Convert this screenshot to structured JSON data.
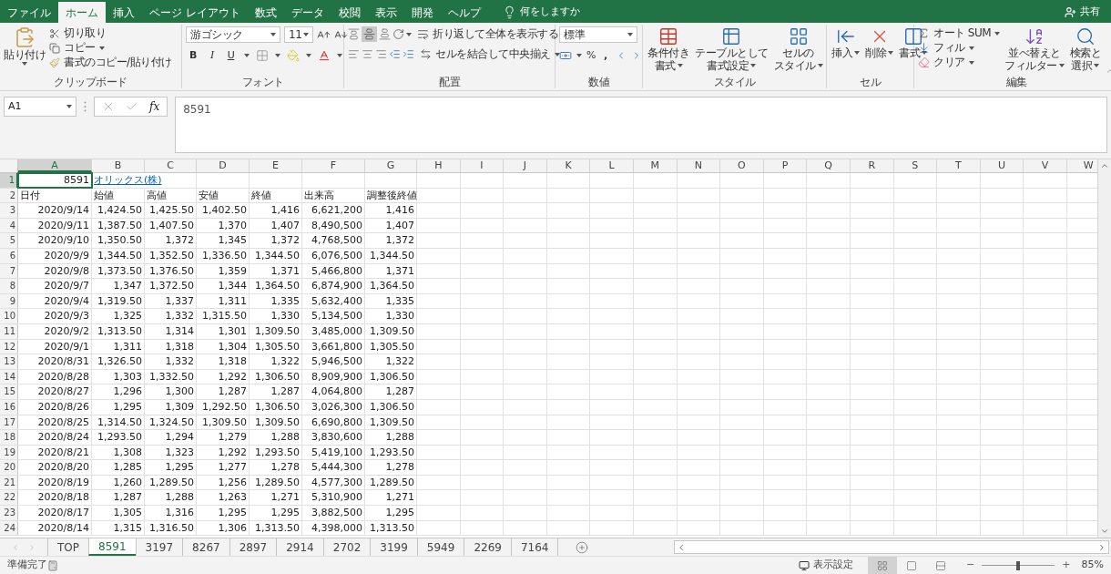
{
  "menu_tabs": [
    {
      "label": "ファイル",
      "selected": false
    },
    {
      "label": "ホーム",
      "selected": true
    },
    {
      "label": "挿入",
      "selected": false
    },
    {
      "label": "ページ レイアウト",
      "selected": false
    },
    {
      "label": "数式",
      "selected": false
    },
    {
      "label": "データ",
      "selected": false
    },
    {
      "label": "校閲",
      "selected": false
    },
    {
      "label": "表示",
      "selected": false
    },
    {
      "label": "開発",
      "selected": false
    },
    {
      "label": "ヘルプ",
      "selected": false
    }
  ],
  "tell_me": "何をしますか",
  "share": "共有",
  "ribbon": {
    "clipboard": {
      "paste": "貼り付け",
      "cut": "切り取り",
      "copy": "コピー",
      "format_painter": "書式のコピー/貼り付け",
      "label": "クリップボード"
    },
    "font": {
      "name": "游ゴシック",
      "size": "11",
      "bold": "B",
      "italic": "I",
      "underline": "U",
      "label": "フォント"
    },
    "alignment": {
      "wrap": "折り返して全体を表示する",
      "merge": "セルを結合して中央揃え",
      "label": "配置"
    },
    "number": {
      "format": "標準",
      "percent": "%",
      "comma": ",",
      "label": "数値"
    },
    "styles": {
      "conditional": [
        "条件付き",
        "書式"
      ],
      "table": [
        "テーブルとして",
        "書式設定"
      ],
      "cell_styles": [
        "セルの",
        "スタイル"
      ],
      "label": "スタイル"
    },
    "cells": {
      "insert": "挿入",
      "delete": "削除",
      "format": "書式",
      "label": "セル"
    },
    "editing": {
      "autosum": "オート SUM",
      "fill": "フィル",
      "clear": "クリア",
      "sort": [
        "並べ替えと",
        "フィルター"
      ],
      "find": [
        "検索と",
        "選択"
      ],
      "label": "編集"
    }
  },
  "name_box": "A1",
  "function_button": "fx",
  "formula": "8591",
  "columns": [
    {
      "label": "A",
      "selected": true
    },
    {
      "label": "B",
      "selected": false
    },
    {
      "label": "C",
      "selected": false
    },
    {
      "label": "D",
      "selected": false
    },
    {
      "label": "E",
      "selected": false
    },
    {
      "label": "F",
      "selected": false
    },
    {
      "label": "G",
      "selected": false
    },
    {
      "label": "H",
      "selected": false
    },
    {
      "label": "I",
      "selected": false
    },
    {
      "label": "J",
      "selected": false
    },
    {
      "label": "K",
      "selected": false
    },
    {
      "label": "L",
      "selected": false
    },
    {
      "label": "M",
      "selected": false
    },
    {
      "label": "N",
      "selected": false
    },
    {
      "label": "O",
      "selected": false
    },
    {
      "label": "P",
      "selected": false
    },
    {
      "label": "Q",
      "selected": false
    },
    {
      "label": "R",
      "selected": false
    },
    {
      "label": "S",
      "selected": false
    },
    {
      "label": "T",
      "selected": false
    },
    {
      "label": "U",
      "selected": false
    },
    {
      "label": "V",
      "selected": false
    },
    {
      "label": "W",
      "selected": false
    }
  ],
  "rows": [
    {
      "number": "1",
      "selected": true,
      "kind": "title",
      "cells": [
        "8591",
        "オリックス(株)"
      ]
    },
    {
      "number": "2",
      "selected": false,
      "kind": "header",
      "cells": [
        "日付",
        "始値",
        "高値",
        "安値",
        "終値",
        "出来高",
        "調整後終値"
      ]
    },
    {
      "number": "3",
      "selected": false,
      "kind": "data",
      "cells": [
        "2020/9/14",
        "1,424.50",
        "1,425.50",
        "1,402.50",
        "1,416",
        "6,621,200",
        "1,416"
      ]
    },
    {
      "number": "4",
      "selected": false,
      "kind": "data",
      "cells": [
        "2020/9/11",
        "1,387.50",
        "1,407.50",
        "1,370",
        "1,407",
        "8,490,500",
        "1,407"
      ]
    },
    {
      "number": "5",
      "selected": false,
      "kind": "data",
      "cells": [
        "2020/9/10",
        "1,350.50",
        "1,372",
        "1,345",
        "1,372",
        "4,768,500",
        "1,372"
      ]
    },
    {
      "number": "6",
      "selected": false,
      "kind": "data",
      "cells": [
        "2020/9/9",
        "1,344.50",
        "1,352.50",
        "1,336.50",
        "1,344.50",
        "6,076,500",
        "1,344.50"
      ]
    },
    {
      "number": "7",
      "selected": false,
      "kind": "data",
      "cells": [
        "2020/9/8",
        "1,373.50",
        "1,376.50",
        "1,359",
        "1,371",
        "5,466,800",
        "1,371"
      ]
    },
    {
      "number": "8",
      "selected": false,
      "kind": "data",
      "cells": [
        "2020/9/7",
        "1,347",
        "1,372.50",
        "1,344",
        "1,364.50",
        "6,874,900",
        "1,364.50"
      ]
    },
    {
      "number": "9",
      "selected": false,
      "kind": "data",
      "cells": [
        "2020/9/4",
        "1,319.50",
        "1,337",
        "1,311",
        "1,335",
        "5,632,400",
        "1,335"
      ]
    },
    {
      "number": "10",
      "selected": false,
      "kind": "data",
      "cells": [
        "2020/9/3",
        "1,325",
        "1,332",
        "1,315.50",
        "1,330",
        "5,134,500",
        "1,330"
      ]
    },
    {
      "number": "11",
      "selected": false,
      "kind": "data",
      "cells": [
        "2020/9/2",
        "1,313.50",
        "1,314",
        "1,301",
        "1,309.50",
        "3,485,000",
        "1,309.50"
      ]
    },
    {
      "number": "12",
      "selected": false,
      "kind": "data",
      "cells": [
        "2020/9/1",
        "1,311",
        "1,318",
        "1,304",
        "1,305.50",
        "3,661,800",
        "1,305.50"
      ]
    },
    {
      "number": "13",
      "selected": false,
      "kind": "data",
      "cells": [
        "2020/8/31",
        "1,326.50",
        "1,332",
        "1,318",
        "1,322",
        "5,946,500",
        "1,322"
      ]
    },
    {
      "number": "14",
      "selected": false,
      "kind": "data",
      "cells": [
        "2020/8/28",
        "1,303",
        "1,332.50",
        "1,292",
        "1,306.50",
        "8,909,900",
        "1,306.50"
      ]
    },
    {
      "number": "15",
      "selected": false,
      "kind": "data",
      "cells": [
        "2020/8/27",
        "1,296",
        "1,300",
        "1,287",
        "1,287",
        "4,064,800",
        "1,287"
      ]
    },
    {
      "number": "16",
      "selected": false,
      "kind": "data",
      "cells": [
        "2020/8/26",
        "1,295",
        "1,309",
        "1,292.50",
        "1,306.50",
        "3,026,300",
        "1,306.50"
      ]
    },
    {
      "number": "17",
      "selected": false,
      "kind": "data",
      "cells": [
        "2020/8/25",
        "1,314.50",
        "1,324.50",
        "1,309.50",
        "1,309.50",
        "6,690,800",
        "1,309.50"
      ]
    },
    {
      "number": "18",
      "selected": false,
      "kind": "data",
      "cells": [
        "2020/8/24",
        "1,293.50",
        "1,294",
        "1,279",
        "1,288",
        "3,830,600",
        "1,288"
      ]
    },
    {
      "number": "19",
      "selected": false,
      "kind": "data",
      "cells": [
        "2020/8/21",
        "1,308",
        "1,323",
        "1,292",
        "1,293.50",
        "5,419,100",
        "1,293.50"
      ]
    },
    {
      "number": "20",
      "selected": false,
      "kind": "data",
      "cells": [
        "2020/8/20",
        "1,285",
        "1,295",
        "1,277",
        "1,278",
        "5,444,300",
        "1,278"
      ]
    },
    {
      "number": "21",
      "selected": false,
      "kind": "data",
      "cells": [
        "2020/8/19",
        "1,260",
        "1,289.50",
        "1,256",
        "1,289.50",
        "4,577,300",
        "1,289.50"
      ]
    },
    {
      "number": "22",
      "selected": false,
      "kind": "data",
      "cells": [
        "2020/8/18",
        "1,287",
        "1,288",
        "1,263",
        "1,271",
        "5,310,900",
        "1,271"
      ]
    },
    {
      "number": "23",
      "selected": false,
      "kind": "data",
      "cells": [
        "2020/8/17",
        "1,305",
        "1,316",
        "1,295",
        "1,295",
        "3,882,500",
        "1,295"
      ]
    },
    {
      "number": "24",
      "selected": false,
      "kind": "data",
      "cells": [
        "2020/8/14",
        "1,315",
        "1,316.50",
        "1,306",
        "1,313.50",
        "4,398,000",
        "1,313.50"
      ]
    }
  ],
  "sheet_tabs": [
    {
      "label": "TOP",
      "selected": false
    },
    {
      "label": "8591",
      "selected": true
    },
    {
      "label": "3197",
      "selected": false
    },
    {
      "label": "8267",
      "selected": false
    },
    {
      "label": "2897",
      "selected": false
    },
    {
      "label": "2914",
      "selected": false
    },
    {
      "label": "2702",
      "selected": false
    },
    {
      "label": "3199",
      "selected": false
    },
    {
      "label": "5949",
      "selected": false
    },
    {
      "label": "2269",
      "selected": false
    },
    {
      "label": "7164",
      "selected": false
    }
  ],
  "status": "準備完了",
  "display_settings": "表示設定",
  "view_buttons": [
    {
      "selected": true
    },
    {
      "selected": false
    },
    {
      "selected": false
    }
  ],
  "zoom": {
    "level": 0.5,
    "reading": "85%",
    "minus": "−",
    "plus": "+"
  }
}
